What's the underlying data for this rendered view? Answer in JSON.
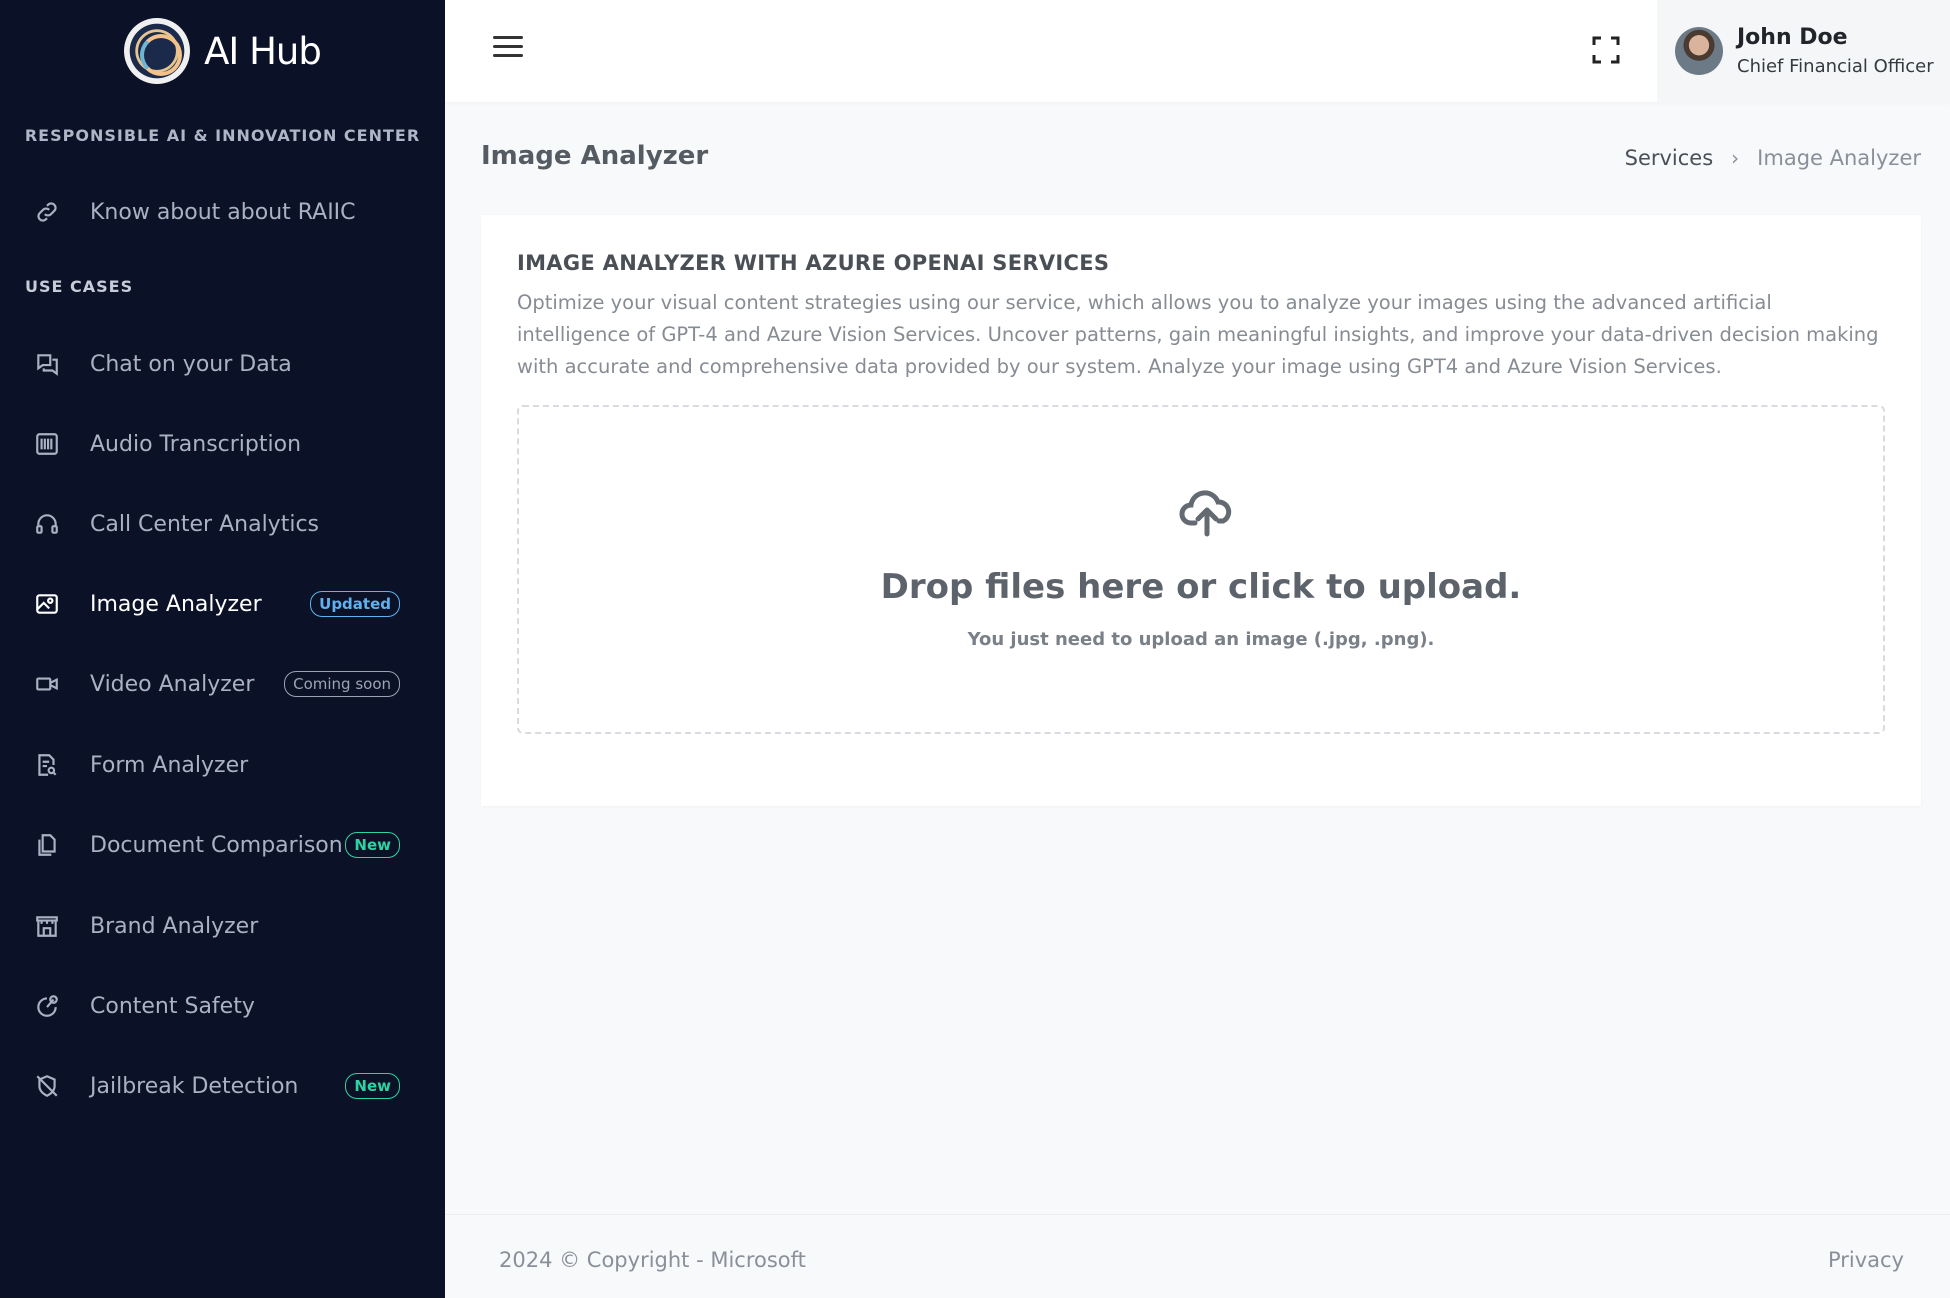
{
  "brand": {
    "name": "AI Hub"
  },
  "sidebar": {
    "org_title": "RESPONSIBLE AI & INNOVATION CENTER",
    "about_item": "Know about about RAIIC",
    "section_label": "USE CASES",
    "items": [
      {
        "label": "Chat on your Data",
        "icon": "chat-icon"
      },
      {
        "label": "Audio Transcription",
        "icon": "waveform-icon"
      },
      {
        "label": "Call Center Analytics",
        "icon": "headset-icon"
      },
      {
        "label": "Image Analyzer",
        "icon": "image-icon",
        "badge": "Updated",
        "active": true
      },
      {
        "label": "Video Analyzer",
        "icon": "video-camera-icon",
        "badge": "Coming soon"
      },
      {
        "label": "Form Analyzer",
        "icon": "form-search-icon"
      },
      {
        "label": "Document Comparison",
        "icon": "documents-icon",
        "badge": "New"
      },
      {
        "label": "Brand Analyzer",
        "icon": "storefront-icon"
      },
      {
        "label": "Content Safety",
        "icon": "safety-icon"
      },
      {
        "label": "Jailbreak Detection",
        "icon": "shield-off-icon",
        "badge": "New"
      }
    ]
  },
  "header": {
    "user_name": "John Doe",
    "user_role": "Chief Financial Officer"
  },
  "page": {
    "title": "Image Analyzer",
    "breadcrumb": [
      "Services",
      "Image Analyzer"
    ]
  },
  "card": {
    "title": "IMAGE ANALYZER WITH AZURE OPENAI SERVICES",
    "description": "Optimize your visual content strategies using our service, which allows you to analyze your images using the advanced artificial intelligence of GPT-4 and Azure Vision Services. Uncover patterns, gain meaningful insights, and improve your data-driven decision making with accurate and comprehensive data provided by our system. Analyze your image using GPT4 and Azure Vision Services.",
    "drop_text": "Drop files here or click to upload.",
    "drop_hint": "You just need to upload an image (.jpg, .png)."
  },
  "footer": {
    "copyright": "2024 © Copyright - Microsoft",
    "privacy": "Privacy"
  },
  "colors": {
    "sidebar_bg": "#0b1227",
    "badge_updated": "#5fb2f0",
    "badge_new": "#2dd4a2"
  }
}
